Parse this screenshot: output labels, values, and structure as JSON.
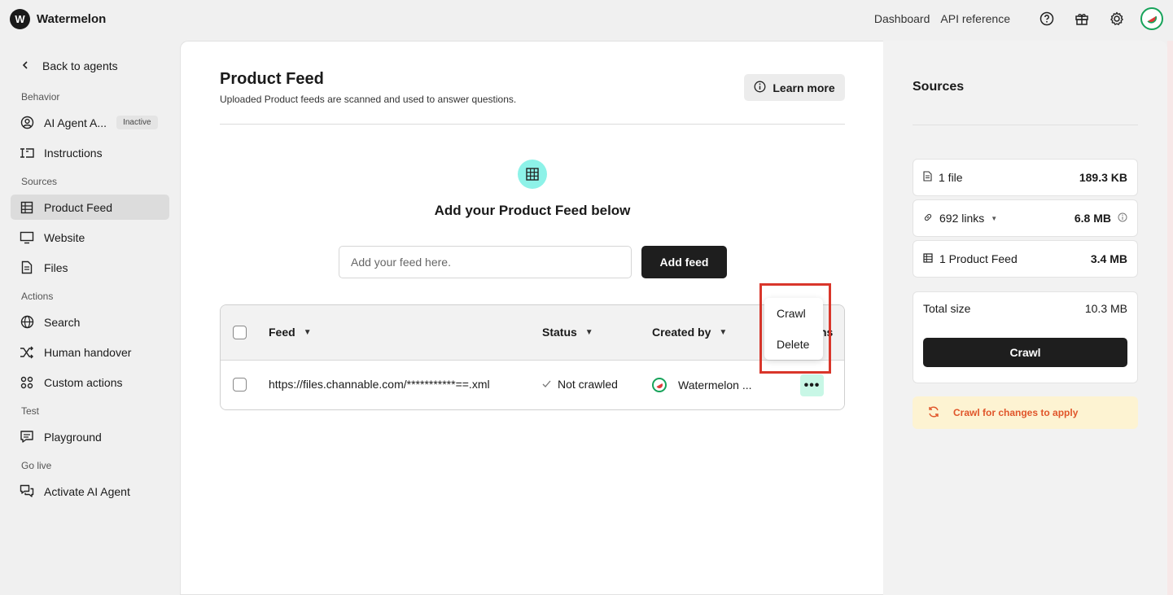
{
  "brand": {
    "logo_letter": "W",
    "name": "Watermelon"
  },
  "topnav": {
    "dashboard": "Dashboard",
    "api_reference": "API reference",
    "icons": [
      "help-icon",
      "gift-icon",
      "gear-icon",
      "user-avatar"
    ]
  },
  "sidebar": {
    "back": "Back to agents",
    "sections": {
      "behavior": "Behavior",
      "sources": "Sources",
      "actions": "Actions",
      "test": "Test",
      "golive": "Go live"
    },
    "items": {
      "ai_agent": "AI Agent A...",
      "ai_agent_badge": "Inactive",
      "instructions": "Instructions",
      "product_feed": "Product Feed",
      "website": "Website",
      "files": "Files",
      "search": "Search",
      "human_handover": "Human handover",
      "custom_actions": "Custom actions",
      "playground": "Playground",
      "activate": "Activate AI Agent"
    }
  },
  "main": {
    "title": "Product Feed",
    "subtitle": "Uploaded Product feeds are scanned and used to answer questions.",
    "learn_more": "Learn more",
    "add_heading": "Add your Product Feed below",
    "input_placeholder": "Add your feed here.",
    "add_button": "Add feed",
    "table": {
      "headers": {
        "feed": "Feed",
        "status": "Status",
        "created_by": "Created by",
        "actions_fragment": "ns"
      },
      "rows": [
        {
          "feed": "https://files.channable.com/***********==.xml",
          "status": "Not crawled",
          "created_by": "Watermelon ...",
          "more": "•••"
        }
      ]
    },
    "menu": {
      "crawl": "Crawl",
      "delete": "Delete"
    }
  },
  "sources": {
    "title": "Sources",
    "rows": [
      {
        "label": "1 file",
        "size": "189.3 KB"
      },
      {
        "label": "692 links",
        "size": "6.8 MB"
      },
      {
        "label": "1 Product Feed",
        "size": "3.4 MB"
      }
    ],
    "total_label": "Total size",
    "total_value": "10.3 MB",
    "crawl_button": "Crawl",
    "notice": "Crawl for changes to apply"
  },
  "colors": {
    "accent_teal": "#8df2e8",
    "highlight_red": "#d9362b",
    "notice_orange": "#e0552a",
    "avatar_green": "#17a35a"
  }
}
